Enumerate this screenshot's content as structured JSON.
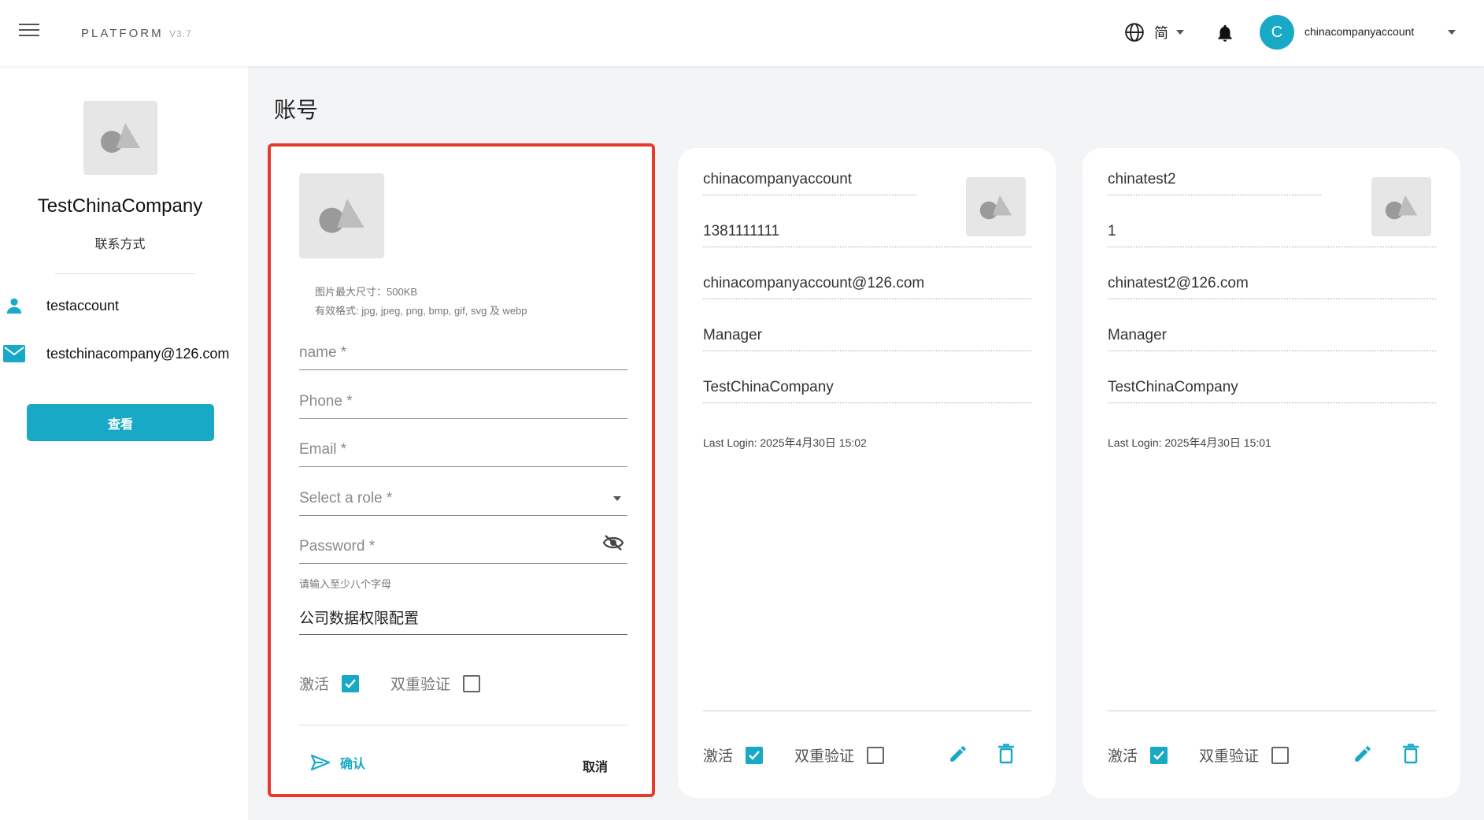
{
  "header": {
    "brand": "PLATFORM",
    "version": "V3.7",
    "language": "简",
    "avatar_letter": "C",
    "account_name": "chinacompanyaccount"
  },
  "sidebar": {
    "company_name": "TestChinaCompany",
    "contact_title": "联系方式",
    "user": "testaccount",
    "email": "testchinacompany@126.com",
    "view_button": "查看"
  },
  "page_title": "账号",
  "new_account_form": {
    "image_hint_1": "图片最大尺寸：500KB",
    "image_hint_2": "有效格式: jpg, jpeg, png, bmp, gif, svg 及 webp",
    "name_placeholder": "name *",
    "phone_placeholder": "Phone *",
    "email_placeholder": "Email *",
    "role_placeholder": "Select a role *",
    "password_placeholder": "Password *",
    "password_hint": "请输入至少八个字母",
    "data_permission": "公司数据权限配置",
    "active_label": "激活",
    "active_checked": true,
    "two_factor_label": "双重验证",
    "two_factor_checked": false,
    "confirm_label": "确认",
    "cancel_label": "取消"
  },
  "accounts": [
    {
      "name": "chinacompanyaccount",
      "phone": "1381111111",
      "email": "chinacompanyaccount@126.com",
      "role": "Manager",
      "company": "TestChinaCompany",
      "last_login": "Last Login: 2025年4月30日 15:02",
      "active_label": "激活",
      "active_checked": true,
      "two_factor_label": "双重验证",
      "two_factor_checked": false
    },
    {
      "name": "chinatest2",
      "phone": "1",
      "email": "chinatest2@126.com",
      "role": "Manager",
      "company": "TestChinaCompany",
      "last_login": "Last Login: 2025年4月30日 15:01",
      "active_label": "激活",
      "active_checked": true,
      "two_factor_label": "双重验证",
      "two_factor_checked": false
    }
  ],
  "colors": {
    "accent": "#18a9c6",
    "highlight_border": "#e53b2c",
    "placeholder_gray": "#e6e6e6"
  }
}
